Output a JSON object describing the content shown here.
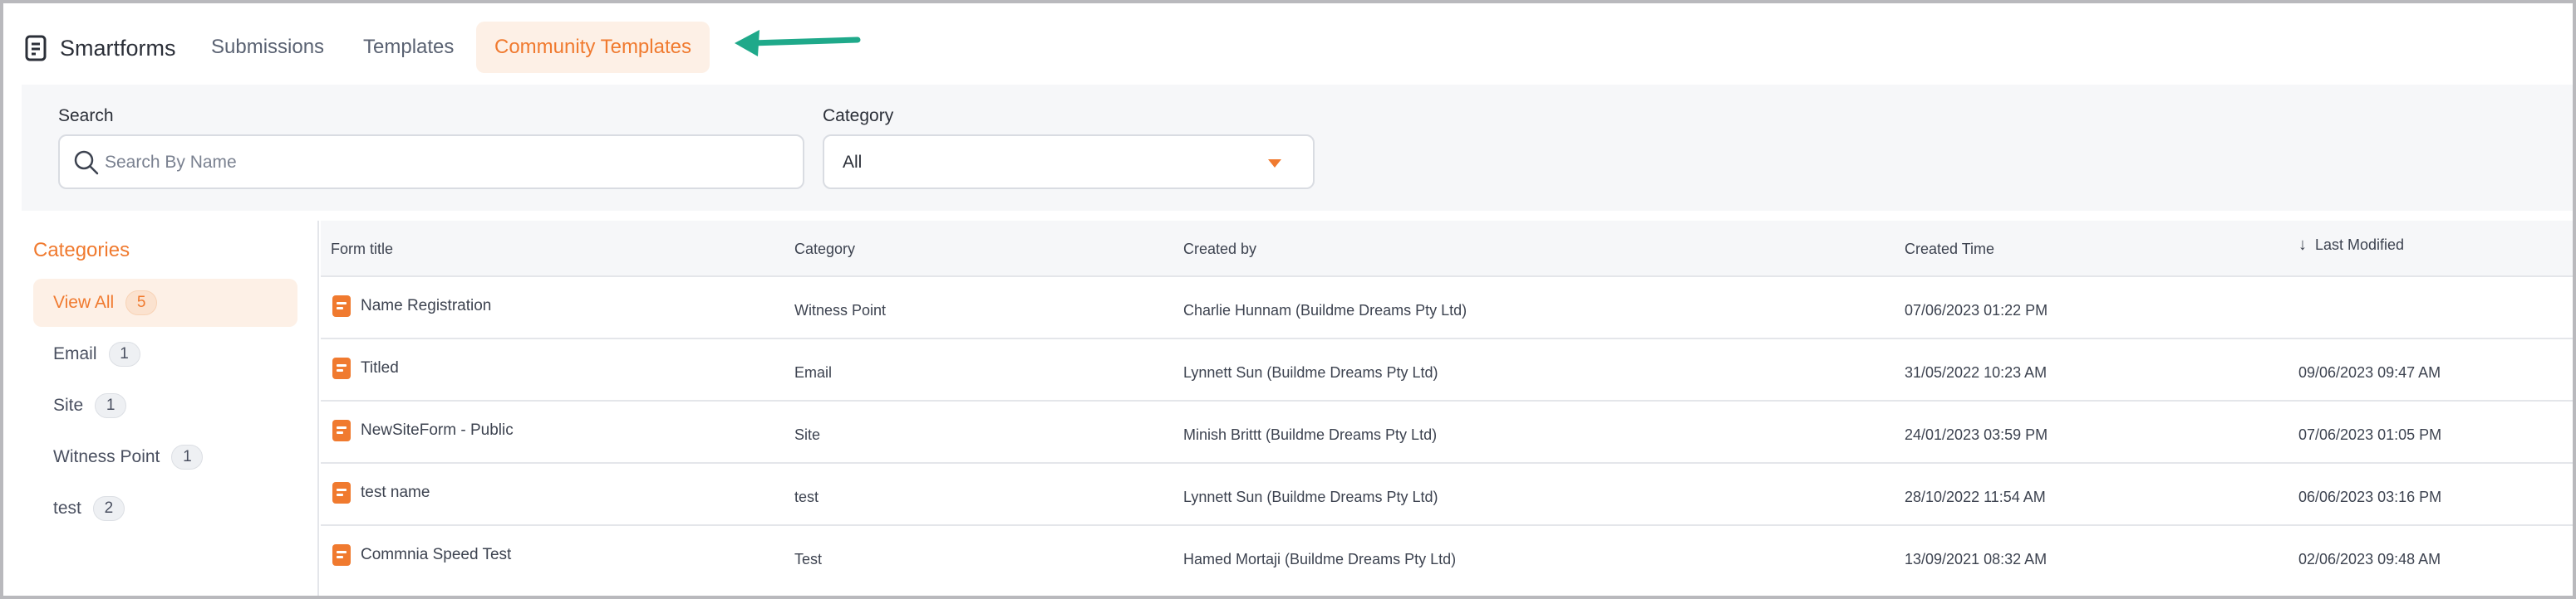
{
  "app": {
    "name": "Smartforms",
    "icon": "document-icon"
  },
  "nav": {
    "tabs": [
      {
        "label": "Submissions",
        "active": false
      },
      {
        "label": "Templates",
        "active": false
      },
      {
        "label": "Community Templates",
        "active": true
      }
    ]
  },
  "filters": {
    "search_label": "Search",
    "search_placeholder": "Search By Name",
    "search_value": "",
    "category_label": "Category",
    "category_value": "All"
  },
  "sidebar": {
    "title": "Categories",
    "items": [
      {
        "label": "View All",
        "count": "5",
        "active": true
      },
      {
        "label": "Email",
        "count": "1",
        "active": false
      },
      {
        "label": "Site",
        "count": "1",
        "active": false
      },
      {
        "label": "Witness Point",
        "count": "1",
        "active": false
      },
      {
        "label": "test",
        "count": "2",
        "active": false
      }
    ]
  },
  "table": {
    "columns": {
      "title": "Form title",
      "category": "Category",
      "created_by": "Created by",
      "created_time": "Created Time",
      "last_modified": "Last Modified"
    },
    "sort_icon": "arrow-down-icon",
    "rows": [
      {
        "title": "Name Registration",
        "category": "Witness Point",
        "created_by": "Charlie Hunnam (Buildme Dreams Pty Ltd)",
        "created_time": "07/06/2023 01:22 PM",
        "last_modified": ""
      },
      {
        "title": "Titled",
        "category": "Email",
        "created_by": "Lynnett Sun (Buildme Dreams Pty Ltd)",
        "created_time": "31/05/2022 10:23 AM",
        "last_modified": "09/06/2023 09:47 AM"
      },
      {
        "title": "NewSiteForm - Public",
        "category": "Site",
        "created_by": "Minish Brittt (Buildme Dreams Pty Ltd)",
        "created_time": "24/01/2023 03:59 PM",
        "last_modified": "07/06/2023 01:05 PM"
      },
      {
        "title": "test name",
        "category": "test",
        "created_by": "Lynnett Sun (Buildme Dreams Pty Ltd)",
        "created_time": "28/10/2022 11:54 AM",
        "last_modified": "06/06/2023 03:16 PM"
      },
      {
        "title": "Commnia Speed Test",
        "category": "Test",
        "created_by": "Hamed Mortaji (Buildme Dreams Pty Ltd)",
        "created_time": "13/09/2021 08:32 AM",
        "last_modified": "02/06/2023 09:48 AM"
      }
    ]
  },
  "colors": {
    "accent": "#f07a2f",
    "accent_bg": "#fdf0e6",
    "annotation_arrow": "#1fa98a"
  }
}
